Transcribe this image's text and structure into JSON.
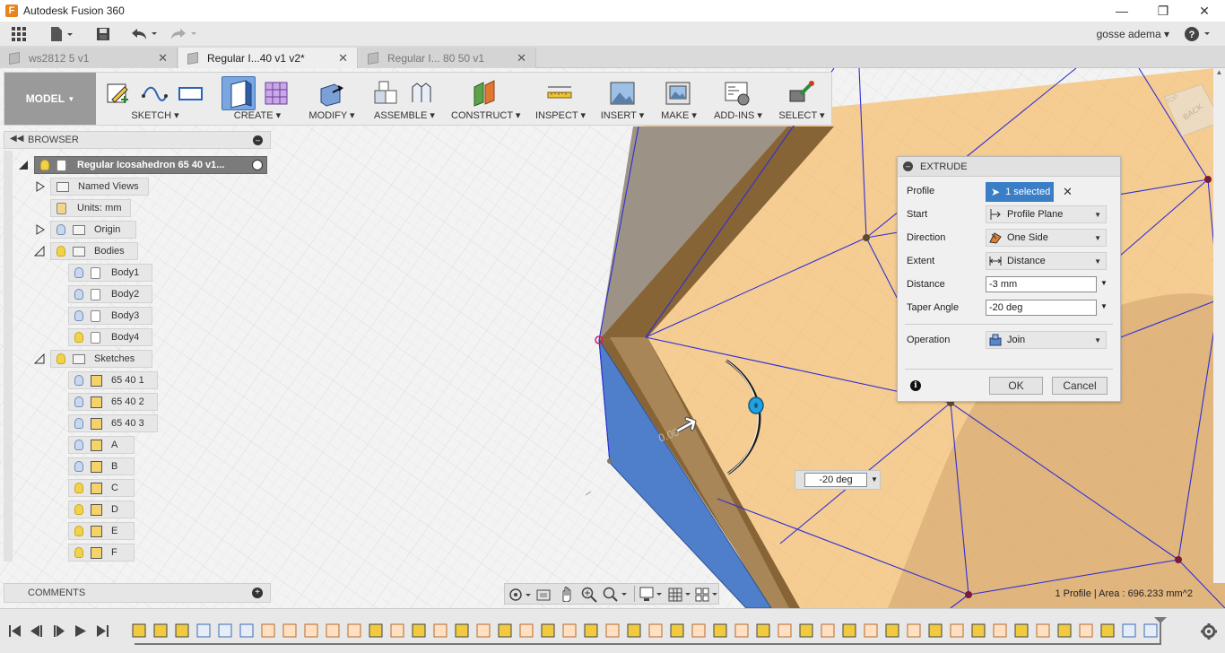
{
  "app": {
    "title": "Autodesk Fusion 360",
    "logo_letter": "F"
  },
  "user": {
    "name": "gosse adema"
  },
  "tabs": [
    {
      "label": "ws2812 5  v1",
      "active": false
    },
    {
      "label": "Regular I...40 v1 v2*",
      "active": true
    },
    {
      "label": "Regular I... 80 50 v1",
      "active": false
    }
  ],
  "toolbar": {
    "workspace": "MODEL",
    "groups": [
      {
        "label": "SKETCH"
      },
      {
        "label": "CREATE"
      },
      {
        "label": "MODIFY"
      },
      {
        "label": "ASSEMBLE"
      },
      {
        "label": "CONSTRUCT"
      },
      {
        "label": "INSPECT"
      },
      {
        "label": "INSERT"
      },
      {
        "label": "MAKE"
      },
      {
        "label": "ADD-INS"
      },
      {
        "label": "SELECT"
      }
    ]
  },
  "viewcube": {
    "top": "TOP",
    "back": "BACK"
  },
  "browser": {
    "title": "BROWSER",
    "root": "Regular Icosahedron 65 40 v1...",
    "items": [
      {
        "label": "Named Views"
      },
      {
        "label": "Units: mm"
      },
      {
        "label": "Origin"
      },
      {
        "label": "Bodies"
      },
      {
        "label": "Body1"
      },
      {
        "label": "Body2"
      },
      {
        "label": "Body3"
      },
      {
        "label": "Body4"
      },
      {
        "label": "Sketches"
      },
      {
        "label": "65 40 1"
      },
      {
        "label": "65 40 2"
      },
      {
        "label": "65 40 3"
      },
      {
        "label": "A"
      },
      {
        "label": "B"
      },
      {
        "label": "C"
      },
      {
        "label": "D"
      },
      {
        "label": "E"
      },
      {
        "label": "F"
      }
    ]
  },
  "comments": {
    "title": "COMMENTS"
  },
  "extrude": {
    "title": "EXTRUDE",
    "profile_label": "Profile",
    "profile_value": "1 selected",
    "start_label": "Start",
    "start_value": "Profile Plane",
    "direction_label": "Direction",
    "direction_value": "One Side",
    "extent_label": "Extent",
    "extent_value": "Distance",
    "distance_label": "Distance",
    "distance_value": "-3 mm",
    "taper_label": "Taper Angle",
    "taper_value": "-20 deg",
    "operation_label": "Operation",
    "operation_value": "Join",
    "ok": "OK",
    "cancel": "Cancel"
  },
  "manipulator": {
    "angle_value": "-20 deg",
    "dimension_text": "0.00"
  },
  "status": {
    "text": "1 Profile | Area : 696.233 mm^2"
  },
  "colors": {
    "accent": "#3a7fc6",
    "face": "#f5cf94",
    "selected_face": "#4f7fcb",
    "edge": "#2f2fd6"
  }
}
